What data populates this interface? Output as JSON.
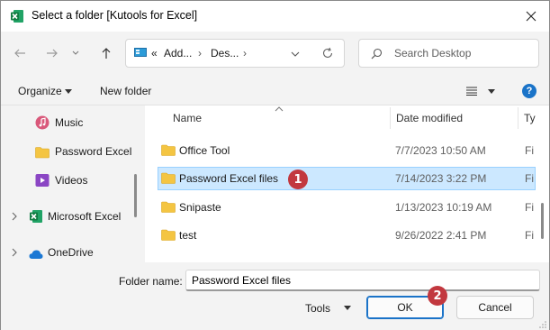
{
  "window": {
    "title": "Select a folder [Kutools for Excel]",
    "close_icon": "close-icon"
  },
  "nav": {
    "back_icon": "arrow-left-icon",
    "forward_icon": "arrow-right-icon",
    "recent_icon": "chevron-down-icon",
    "up_icon": "arrow-up-icon",
    "breadcrumb": [
      "Add...",
      "Des..."
    ],
    "breadcrumb_overflow": "«",
    "refresh_icon": "refresh-icon",
    "search_placeholder": "Search Desktop"
  },
  "commands": {
    "organize": "Organize",
    "new_folder": "New folder",
    "help": "?"
  },
  "sidebar": {
    "items": [
      {
        "label": "Music",
        "icon": "music-icon"
      },
      {
        "label": "Password Excel",
        "icon": "folder-icon"
      },
      {
        "label": "Videos",
        "icon": "video-icon"
      },
      {
        "label": "Microsoft Excel",
        "icon": "excel-icon"
      },
      {
        "label": "OneDrive",
        "icon": "cloud-icon"
      }
    ]
  },
  "filelist": {
    "columns": [
      "Name",
      "Date modified",
      "Ty"
    ],
    "rows": [
      {
        "name": "Office Tool",
        "date": "7/7/2023 10:50 AM",
        "type": "Fi",
        "selected": false
      },
      {
        "name": "Password Excel files",
        "date": "7/14/2023 3:22 PM",
        "type": "Fi",
        "selected": true
      },
      {
        "name": "Snipaste",
        "date": "1/13/2023 10:19 AM",
        "type": "Fi",
        "selected": false
      },
      {
        "name": "test",
        "date": "9/26/2022 2:41 PM",
        "type": "Fi",
        "selected": false
      }
    ]
  },
  "footer": {
    "folder_name_label": "Folder name:",
    "folder_name_value": "Password Excel files",
    "tools_label": "Tools",
    "ok_label": "OK",
    "cancel_label": "Cancel"
  },
  "annotations": {
    "step1": "1",
    "step2": "2",
    "color": "#c2383f"
  },
  "colors": {
    "accent": "#1a73c8",
    "selection": "#cce8ff",
    "folder": "#f4c542"
  }
}
